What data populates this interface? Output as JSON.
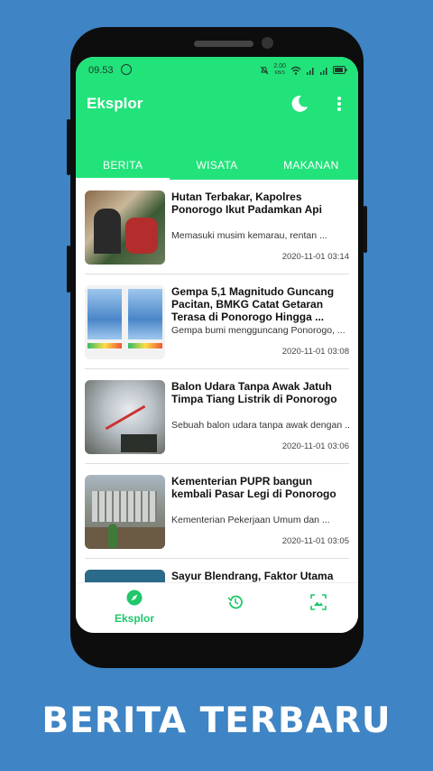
{
  "status": {
    "time": "09.53",
    "net_speed_top": "2.00",
    "net_speed_unit": "KB/S"
  },
  "appbar": {
    "title": "Eksplor"
  },
  "tabs": [
    {
      "label": "BERITA",
      "active": true
    },
    {
      "label": "WISATA",
      "active": false
    },
    {
      "label": "MAKANAN",
      "active": false
    }
  ],
  "articles": [
    {
      "title": "Hutan Terbakar, Kapolres Ponorogo Ikut Padamkan Api",
      "excerpt": "Memasuki musim kemarau, rentan ...",
      "date": "2020-11-01 03:14"
    },
    {
      "title": "Gempa 5,1 Magnitudo Guncang Pacitan, BMKG Catat Getaran Terasa di Ponorogo Hingga ...",
      "excerpt": "Gempa bumi mengguncang Ponorogo, ...",
      "date": "2020-11-01 03:08"
    },
    {
      "title": "Balon Udara Tanpa Awak Jatuh Timpa Tiang Listrik di Ponorogo",
      "excerpt": "Sebuah balon udara tanpa awak dengan ...",
      "date": "2020-11-01 03:06"
    },
    {
      "title": "Kementerian PUPR bangun kembali Pasar Legi di Ponorogo",
      "excerpt": "Kementerian Pekerjaan Umum dan ...",
      "date": "2020-11-01 03:05"
    },
    {
      "title": "Sayur Blendrang, Faktor Utama Penyebab Ibu-Ibu di Ponorogo Terserang Kolestrol",
      "excerpt": "",
      "date": ""
    }
  ],
  "bottom_nav": {
    "explore_label": "Eksplor"
  },
  "caption": "BERITA TERBARU",
  "colors": {
    "accent": "#22e27a",
    "background": "#3f84c4",
    "nav_active": "#1fc76a"
  }
}
